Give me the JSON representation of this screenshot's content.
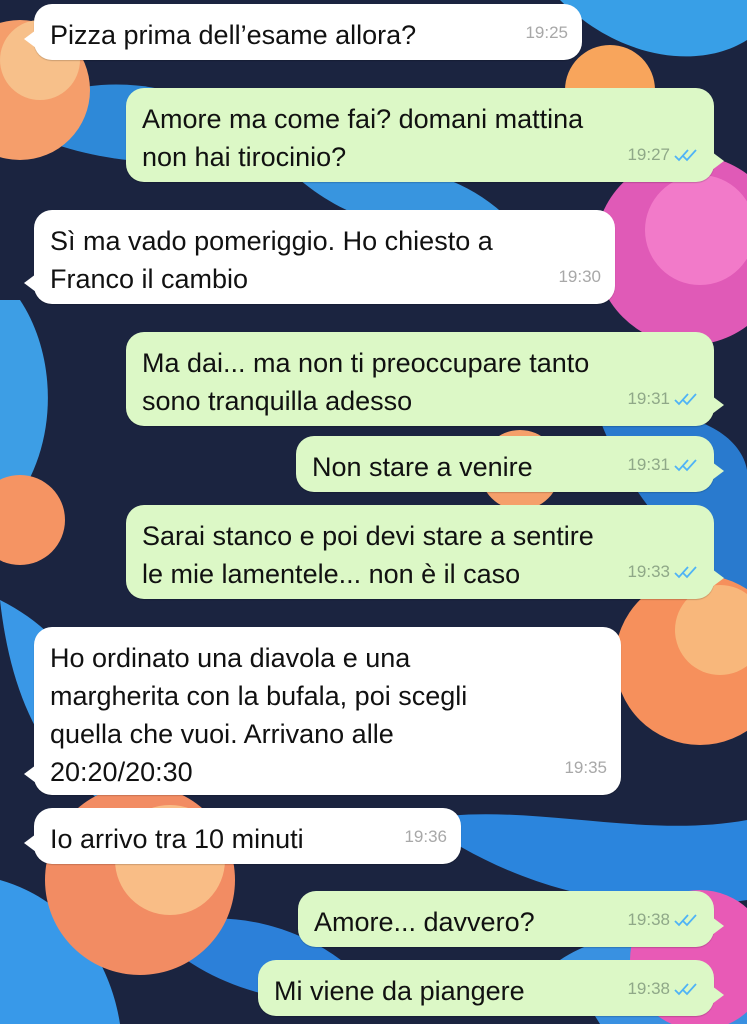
{
  "colors": {
    "incoming_bubble": "#ffffff",
    "outgoing_bubble": "#dcf8c6",
    "read_ticks": "#4fb3f6",
    "timestamp": "#a8a8a8"
  },
  "wallpaper": {
    "description_icon": "tropical-flowers-wallpaper"
  },
  "messages": [
    {
      "direction": "in",
      "text": "Pizza prima dell’esame allora?",
      "time": "19:25"
    },
    {
      "direction": "out",
      "text": "Amore ma come fai? domani mattina\nnon hai tirocinio?",
      "time": "19:27",
      "status": "read"
    },
    {
      "direction": "in",
      "text": "Sì ma vado pomeriggio. Ho chiesto a\nFranco il cambio",
      "time": "19:30"
    },
    {
      "direction": "out",
      "text": "Ma dai... ma non ti preoccupare tanto\nsono tranquilla adesso",
      "time": "19:31",
      "status": "read"
    },
    {
      "direction": "out",
      "text": "Non stare a venire",
      "time": "19:31",
      "status": "read"
    },
    {
      "direction": "out",
      "text": "Sarai stanco e poi devi stare a sentire\nle mie lamentele... non è il caso",
      "time": "19:33",
      "status": "read"
    },
    {
      "direction": "in",
      "text": "Ho ordinato una diavola e una\nmargherita con la bufala, poi scegli\nquella che vuoi. Arrivano alle\n20:20/20:30",
      "time": "19:35"
    },
    {
      "direction": "in",
      "text": "Io arrivo tra 10 minuti",
      "time": "19:36"
    },
    {
      "direction": "out",
      "text": "Amore... davvero?",
      "time": "19:38",
      "status": "read"
    },
    {
      "direction": "out",
      "text": "Mi viene da piangere",
      "time": "19:38",
      "status": "read"
    }
  ]
}
